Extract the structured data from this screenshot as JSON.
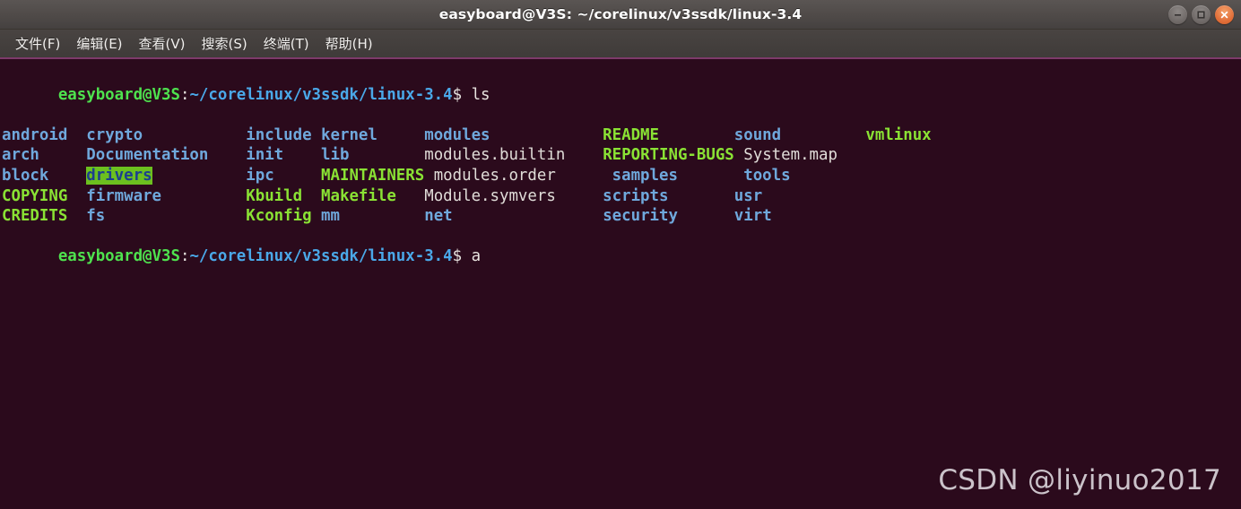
{
  "window": {
    "title": "easyboard@V3S: ~/corelinux/v3ssdk/linux-3.4",
    "controls": [
      {
        "name": "minimize",
        "label": "—"
      },
      {
        "name": "maximize",
        "label": "□"
      },
      {
        "name": "close",
        "label": "✕"
      }
    ],
    "colors": {
      "titlebar": "#504b49",
      "menubar": "#423e3c",
      "menubar_accent": "#7d3a6a",
      "terminal_bg": "#2b0a1c",
      "close_button": "#e2703a",
      "prompt_user": "#4ee24e",
      "prompt_path": "#4aa8e8",
      "dir": "#6fa8dc",
      "exec": "#8ae234",
      "file": "#e0dcd8",
      "selection_bg": "#6cc01f",
      "selection_fg": "#1c3f8f"
    }
  },
  "menubar": {
    "items": [
      {
        "label": "文件(F)"
      },
      {
        "label": "编辑(E)"
      },
      {
        "label": "查看(V)"
      },
      {
        "label": "搜索(S)"
      },
      {
        "label": "终端(T)"
      },
      {
        "label": "帮助(H)"
      }
    ]
  },
  "terminal": {
    "prompt": {
      "user_host": "easyboard@V3S",
      "colon": ":",
      "path": "~/corelinux/v3ssdk/linux-3.4",
      "sigil": "$"
    },
    "command_first": " ls",
    "command_last": " a",
    "ls_rows": [
      [
        {
          "text": "android",
          "type": "dir",
          "width": 9
        },
        {
          "text": "crypto",
          "type": "dir",
          "width": 17
        },
        {
          "text": "include",
          "type": "dir",
          "width": 8
        },
        {
          "text": "kernel",
          "type": "dir",
          "width": 11
        },
        {
          "text": "modules",
          "type": "dir",
          "width": 19
        },
        {
          "text": "README",
          "type": "exec",
          "width": 14
        },
        {
          "text": "sound",
          "type": "dir",
          "width": 14
        },
        {
          "text": "vmlinux",
          "type": "exec",
          "width": 7
        }
      ],
      [
        {
          "text": "arch",
          "type": "dir",
          "width": 9
        },
        {
          "text": "Documentation",
          "type": "dir",
          "width": 17
        },
        {
          "text": "init",
          "type": "dir",
          "width": 8
        },
        {
          "text": "lib",
          "type": "dir",
          "width": 11
        },
        {
          "text": "modules.builtin",
          "type": "file",
          "width": 19
        },
        {
          "text": "REPORTING-BUGS",
          "type": "exec",
          "width": 14
        },
        {
          "text": "System.map",
          "type": "file",
          "width": 14
        }
      ],
      [
        {
          "text": "block",
          "type": "dir",
          "width": 9
        },
        {
          "text": "drivers",
          "type": "selected",
          "width": 17
        },
        {
          "text": "ipc",
          "type": "dir",
          "width": 8
        },
        {
          "text": "MAINTAINERS",
          "type": "exec",
          "width": 11
        },
        {
          "text": "modules.order",
          "type": "file",
          "width": 19
        },
        {
          "text": "samples",
          "type": "dir",
          "width": 14
        },
        {
          "text": "tools",
          "type": "dir",
          "width": 14
        }
      ],
      [
        {
          "text": "COPYING",
          "type": "exec",
          "width": 9
        },
        {
          "text": "firmware",
          "type": "dir",
          "width": 17
        },
        {
          "text": "Kbuild",
          "type": "exec",
          "width": 8
        },
        {
          "text": "Makefile",
          "type": "exec",
          "width": 11
        },
        {
          "text": "Module.symvers",
          "type": "file",
          "width": 19
        },
        {
          "text": "scripts",
          "type": "dir",
          "width": 14
        },
        {
          "text": "usr",
          "type": "dir",
          "width": 14
        }
      ],
      [
        {
          "text": "CREDITS",
          "type": "exec",
          "width": 9
        },
        {
          "text": "fs",
          "type": "dir",
          "width": 17
        },
        {
          "text": "Kconfig",
          "type": "exec",
          "width": 8
        },
        {
          "text": "mm",
          "type": "dir",
          "width": 11
        },
        {
          "text": "net",
          "type": "dir",
          "width": 19
        },
        {
          "text": "security",
          "type": "dir",
          "width": 14
        },
        {
          "text": "virt",
          "type": "dir",
          "width": 14
        }
      ]
    ]
  },
  "watermark": {
    "text": "CSDN @liyinuo2017"
  }
}
